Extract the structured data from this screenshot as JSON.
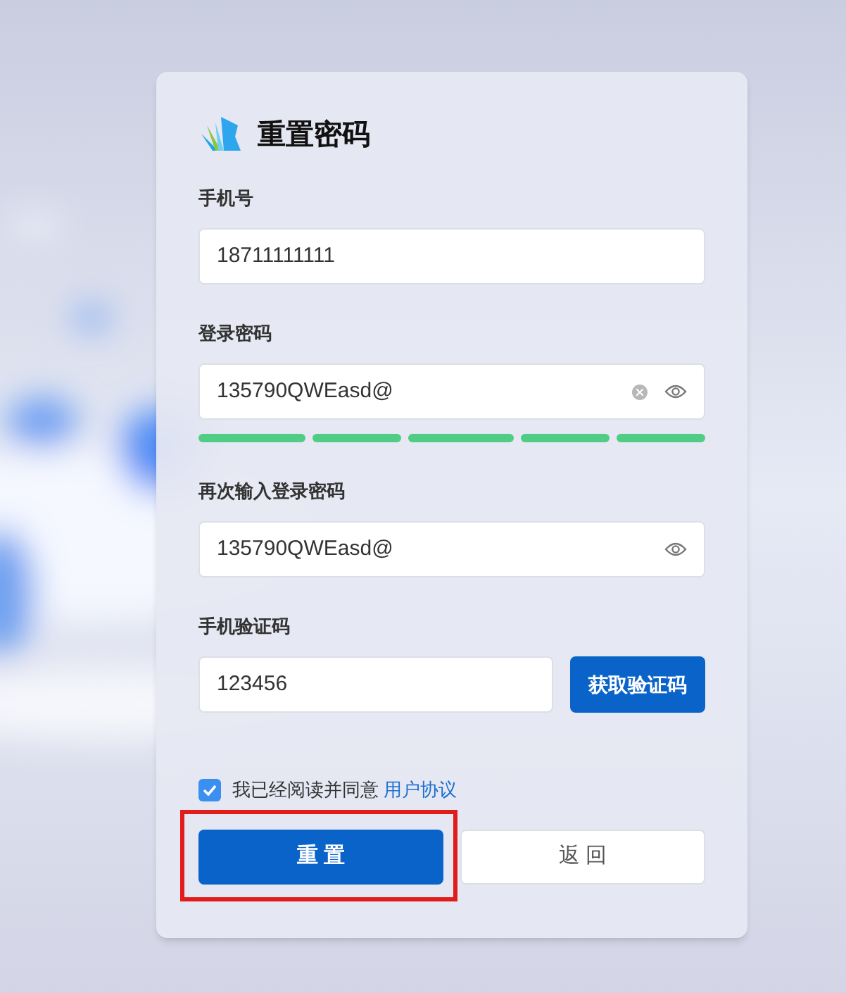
{
  "title": "重置密码",
  "fields": [
    {
      "kind": "text",
      "label": "手机号",
      "value": "18711111111",
      "clearable": false,
      "reveal": false
    },
    {
      "kind": "password",
      "label": "登录密码",
      "value": "135790QWEasd@",
      "clearable": true,
      "reveal": true,
      "strength": [
        {
          "on": true
        },
        {
          "on": true
        },
        {
          "on": true
        },
        {
          "on": true
        },
        {
          "on": true
        }
      ]
    },
    {
      "kind": "password",
      "label": "再次输入登录密码",
      "value": "135790QWEasd@",
      "clearable": false,
      "reveal": true
    },
    {
      "kind": "code",
      "label": "手机验证码",
      "value": "123456",
      "button": "获取验证码"
    }
  ],
  "agreement": {
    "checked": true,
    "text": "我已经阅读并同意",
    "link": "用户协议"
  },
  "buttons": [
    {
      "label": "重 置",
      "kind": "primary",
      "highlighted": true
    },
    {
      "label": "返 回",
      "kind": "secondary",
      "highlighted": false
    }
  ]
}
